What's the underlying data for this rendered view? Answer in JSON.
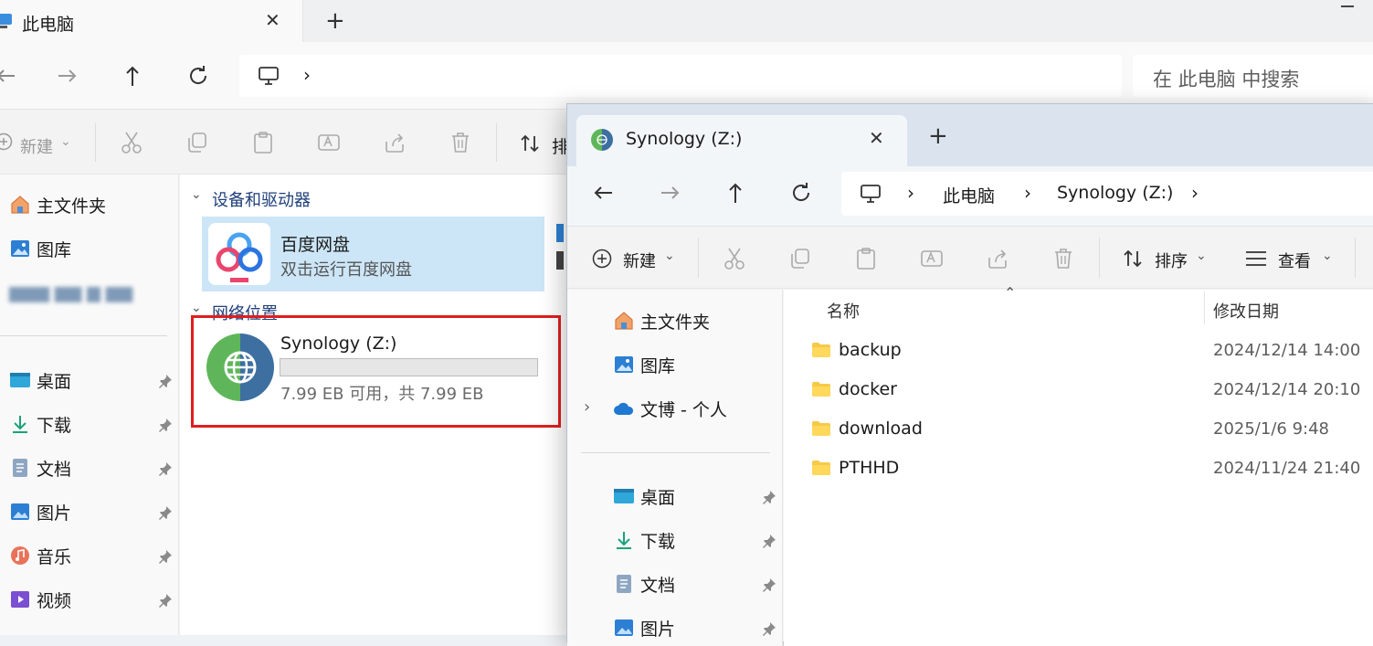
{
  "back_window": {
    "tab_title": "此电脑",
    "new_tab": "+",
    "close": "✕",
    "search_placeholder": "在 此电脑 中搜索",
    "toolbar": {
      "new_label": "新建",
      "sort_label": "排"
    },
    "sidebar": {
      "home": "主文件夹",
      "gallery": "图库",
      "blurred": "▆▆▆ ▆▆ ▆ ▆▆",
      "pinned": [
        "桌面",
        "下载",
        "文档",
        "图片",
        "音乐",
        "视频"
      ]
    },
    "sections": {
      "devices": "设备和驱动器",
      "network": "网络位置"
    },
    "baidu": {
      "name": "百度网盘",
      "desc": "双击运行百度网盘"
    },
    "synology": {
      "name": "Synology (Z:)",
      "capacity": "7.99 EB 可用，共 7.99 EB",
      "used_fraction": 0.0
    }
  },
  "front_window": {
    "tab_title": "Synology (Z:)",
    "close": "✕",
    "new_tab": "+",
    "breadcrumb": [
      "此电脑",
      "Synology (Z:)"
    ],
    "toolbar": {
      "new_label": "新建",
      "sort_label": "排序",
      "view_label": "查看"
    },
    "sidebar": {
      "home": "主文件夹",
      "gallery": "图库",
      "onedrive": "文博 - 个人",
      "pinned": [
        "桌面",
        "下载",
        "文档",
        "图片"
      ]
    },
    "columns": {
      "name": "名称",
      "modified": "修改日期"
    },
    "files": [
      {
        "name": "backup",
        "modified": "2024/12/14 14:00"
      },
      {
        "name": "docker",
        "modified": "2024/12/14 20:10"
      },
      {
        "name": "download",
        "modified": "2025/1/6 9:48"
      },
      {
        "name": "PTHHD",
        "modified": "2024/11/24 21:40"
      }
    ]
  },
  "colors": {
    "highlight_border": "#e01e1e",
    "accent": "#0067c0",
    "folder": "#f7c948"
  }
}
